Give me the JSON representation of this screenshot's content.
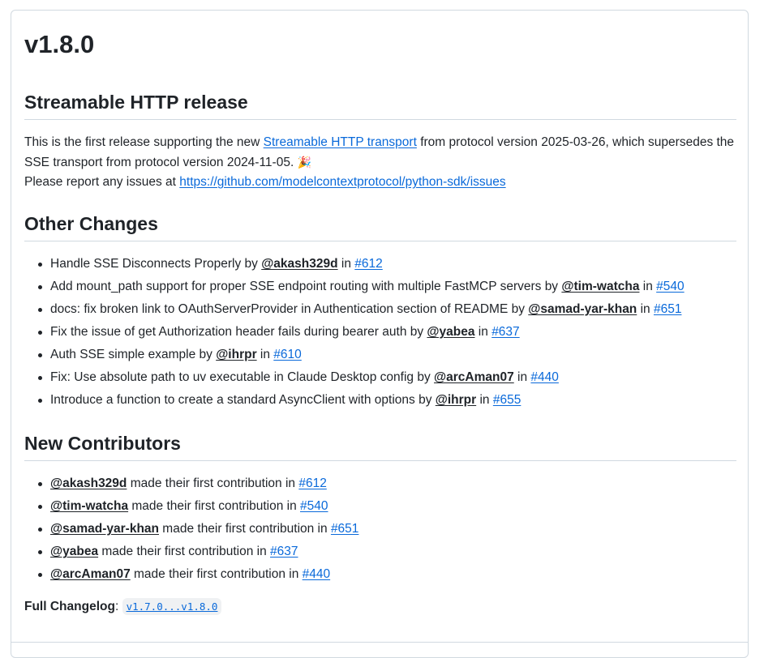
{
  "release": {
    "title": "v1.8.0",
    "streamable": {
      "heading": "Streamable HTTP release",
      "line1_pre": "This is the first release supporting the new ",
      "line1_link": "Streamable HTTP transport",
      "line1_post": " from protocol version 2025-03-26, which supersedes the SSE transport from protocol version 2024-11-05. ",
      "emoji": "🎉",
      "line2_pre": "Please report any issues at ",
      "line2_link": "https://github.com/modelcontextprotocol/python-sdk/issues"
    },
    "other_changes": {
      "heading": "Other Changes",
      "items": [
        {
          "text": "Handle SSE Disconnects Properly by ",
          "user": "@akash329d",
          "in": " in ",
          "pr": "#612"
        },
        {
          "text": "Add mount_path support for proper SSE endpoint routing with multiple FastMCP servers by ",
          "user": "@tim-watcha",
          "in": " in ",
          "pr": "#540"
        },
        {
          "text": "docs: fix broken link to OAuthServerProvider in Authentication section of README by ",
          "user": "@samad-yar-khan",
          "in": " in ",
          "pr": "#651"
        },
        {
          "text": "Fix the issue of get Authorization header fails during bearer auth by ",
          "user": "@yabea",
          "in": " in ",
          "pr": "#637"
        },
        {
          "text": "Auth SSE simple example by ",
          "user": "@ihrpr",
          "in": " in ",
          "pr": "#610"
        },
        {
          "text": "Fix: Use absolute path to uv executable in Claude Desktop config by ",
          "user": "@arcAman07",
          "in": " in ",
          "pr": "#440"
        },
        {
          "text": "Introduce a function to create a standard AsyncClient with options by ",
          "user": "@ihrpr",
          "in": " in ",
          "pr": "#655"
        }
      ]
    },
    "new_contributors": {
      "heading": "New Contributors",
      "items": [
        {
          "user": "@akash329d",
          "text": " made their first contribution in ",
          "pr": "#612"
        },
        {
          "user": "@tim-watcha",
          "text": " made their first contribution in ",
          "pr": "#540"
        },
        {
          "user": "@samad-yar-khan",
          "text": " made their first contribution in ",
          "pr": "#651"
        },
        {
          "user": "@yabea",
          "text": " made their first contribution in ",
          "pr": "#637"
        },
        {
          "user": "@arcAman07",
          "text": " made their first contribution in ",
          "pr": "#440"
        }
      ]
    },
    "full_changelog": {
      "label": "Full Changelog",
      "colon": ": ",
      "compare": "v1.7.0...v1.8.0"
    }
  }
}
